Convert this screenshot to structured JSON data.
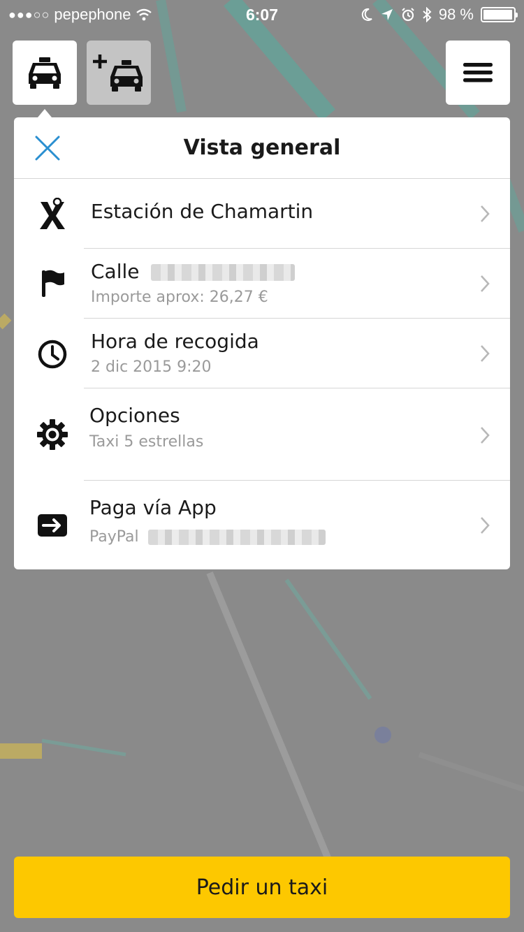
{
  "status_bar": {
    "carrier": "pepephone",
    "time": "6:07",
    "battery": "98 %",
    "battery_level": 0.98
  },
  "toolbar": {
    "taxi_icon": "taxi-icon",
    "add_taxi_icon": "add-taxi-icon",
    "menu_icon": "hamburger-menu-icon"
  },
  "panel": {
    "title": "Vista general",
    "rows": [
      {
        "icon": "pickup-marker-icon",
        "title": "Estación de Chamartin",
        "subtitle": ""
      },
      {
        "icon": "flag-icon",
        "title": "Calle",
        "subtitle": "Importe aprox: 26,27 €"
      },
      {
        "icon": "clock-icon",
        "title": "Hora de recogida",
        "subtitle": "2 dic 2015 9:20"
      },
      {
        "icon": "gear-icon",
        "title": "Opciones",
        "subtitle": "Taxi 5 estrellas"
      },
      {
        "icon": "payment-arrow-icon",
        "title": "Paga vía App",
        "subtitle": "PayPal"
      }
    ]
  },
  "cta": {
    "label": "Pedir un taxi"
  },
  "colors": {
    "accent_yellow": "#fdc800",
    "close_blue": "#2a8fd0",
    "overlay_gray": "#8a8a8a"
  }
}
